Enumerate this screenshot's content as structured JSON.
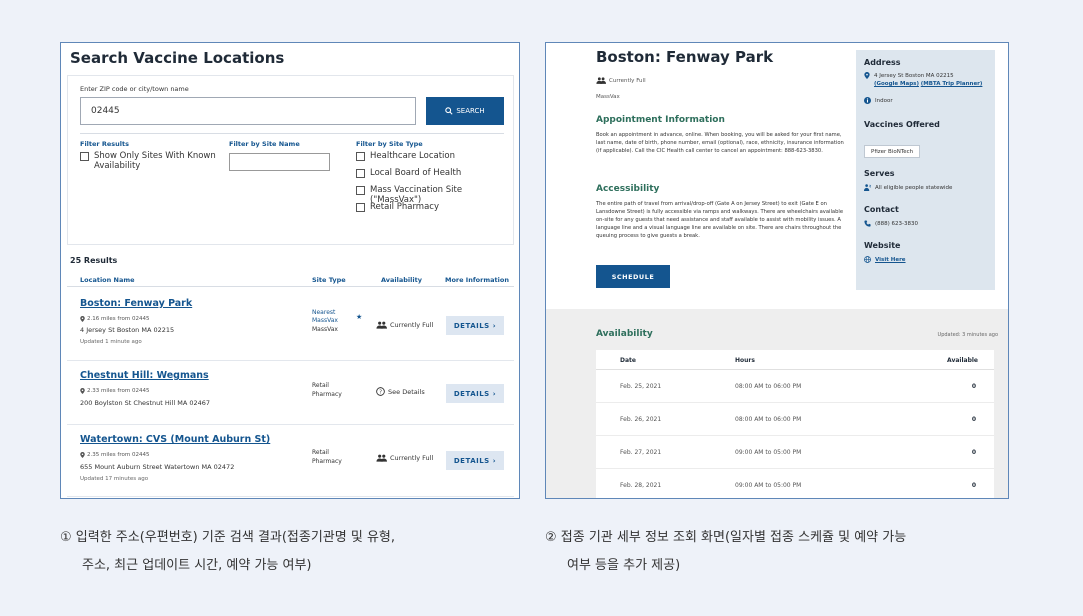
{
  "search": {
    "title": "Search Vaccine Locations",
    "zip_label": "Enter ZIP code or city/town name",
    "zip_value": "02445",
    "button_label": "SEARCH",
    "filter_results_title": "Filter Results",
    "filter_results_option": "Show Only Sites With Known Availability",
    "filter_site_name_title": "Filter by Site Name",
    "filter_site_type_title": "Filter by Site Type",
    "site_types": [
      "Healthcare Location",
      "Local Board of Health",
      "Mass Vaccination Site (\"MassVax\")",
      "Retail Pharmacy"
    ]
  },
  "results": {
    "count": "25 Results",
    "headers": [
      "Location Name",
      "Site Type",
      "Availability",
      "More Information"
    ],
    "rows": [
      {
        "name": "Boston: Fenway Park",
        "distance": "2.16 miles from 02445",
        "address": "4 Jersey St Boston MA 02215",
        "updated": "Updated 1 minute ago",
        "type_line1": "Nearest",
        "type_line2": "MassVax",
        "type_line3": "MassVax",
        "star": "★",
        "availability": "Currently Full",
        "details": "DETAILS"
      },
      {
        "name": "Chestnut Hill: Wegmans",
        "distance": "2.33 miles from 02445",
        "address": "200 Boylston St Chestnut Hill MA 02467",
        "updated": "",
        "type_line1": "Retail",
        "type_line2": "Pharmacy",
        "availability": "See Details",
        "details": "DETAILS"
      },
      {
        "name": "Watertown: CVS (Mount Auburn St)",
        "distance": "2.35 miles from 02445",
        "address": "655 Mount Auburn Street Watertown MA 02472",
        "updated": "Updated 17 minutes ago",
        "type_line1": "Retail",
        "type_line2": "Pharmacy",
        "availability": "Currently Full",
        "details": "DETAILS"
      }
    ]
  },
  "detail": {
    "title": "Boston: Fenway Park",
    "status": "Currently Full",
    "site_type": "MassVax",
    "appointment_title": "Appointment Information",
    "appointment_text": "Book an appointment in advance, online. When booking, you will be asked for your first name, last name, date of birth, phone number, email (optional), race, ethnicity, insurance information (if applicable). Call the CIC Health call center to cancel an appointment: 888-623-3830.",
    "accessibility_title": "Accessibility",
    "accessibility_text": "The entire path of travel from arrival/drop-off (Gate A on Jersey Street) to exit (Gate E on Lansdowne Street) is fully accessible via ramps and walkways. There are wheelchairs available on-site for any guests that need assistance and staff available to assist with mobility issues. A language line and a visual language line are available on site. There are chairs throughout the queuing process to give guests a break.",
    "schedule_label": "SCHEDULE",
    "sidebar": {
      "address_title": "Address",
      "address_line": "4 Jersey St Boston MA 02215",
      "google_maps": "(Google Maps)",
      "mbta": "(MBTA Trip Planner)",
      "indoor": "Indoor",
      "vaccines_title": "Vaccines Offered",
      "vaccine": "Pfizer BioNTech",
      "serves_title": "Serves",
      "serves_text": "All eligible people statewide",
      "contact_title": "Contact",
      "phone": "(888) 623-3830",
      "website_title": "Website",
      "website_link": "Visit Here"
    },
    "availability": {
      "title": "Availability",
      "updated": "Updated: 3 minutes ago",
      "headers": [
        "Date",
        "Hours",
        "Available"
      ],
      "rows": [
        {
          "date": "Feb. 25, 2021",
          "hours": "08:00 AM to 06:00 PM",
          "available": "0"
        },
        {
          "date": "Feb. 26, 2021",
          "hours": "08:00 AM to 06:00 PM",
          "available": "0"
        },
        {
          "date": "Feb. 27, 2021",
          "hours": "09:00 AM to 05:00 PM",
          "available": "0"
        },
        {
          "date": "Feb. 28, 2021",
          "hours": "09:00 AM to 05:00 PM",
          "available": "0"
        }
      ]
    }
  },
  "captions": {
    "left_line1": "① 입력한 주소(우편번호) 기준 검색 결과(접종기관명 및 유형,",
    "left_line2": "주소, 최근 업데이트 시간, 예약 가능 여부)",
    "right_line1": "② 접종 기관 세부 정보 조회 화면(일자별 접종 스케쥴 및 예약 가능",
    "right_line2": "여부 등을 추가 제공)"
  }
}
